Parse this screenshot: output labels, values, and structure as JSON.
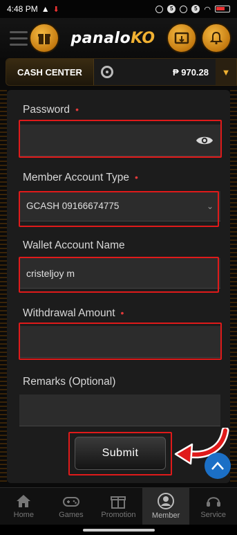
{
  "status_bar": {
    "time": "4:48 PM"
  },
  "header": {
    "logo_text": "panalo",
    "logo_suffix": "KO"
  },
  "cash_center": {
    "label": "CASH CENTER",
    "balance": "₱ 970.28"
  },
  "form": {
    "password": {
      "label": "Password",
      "value": ""
    },
    "account_type": {
      "label": "Member Account Type",
      "value": "GCASH 09166674775"
    },
    "wallet_name": {
      "label": "Wallet Account Name",
      "value": "cristeljoy m"
    },
    "amount": {
      "label": "Withdrawal Amount",
      "value": ""
    },
    "remarks": {
      "label": "Remarks (Optional)",
      "value": ""
    },
    "required_mark": "•",
    "submit_label": "Submit"
  },
  "bottom_nav": [
    {
      "label": "Home",
      "icon": "home-icon"
    },
    {
      "label": "Games",
      "icon": "gamepad-icon"
    },
    {
      "label": "Promotion",
      "icon": "gift-icon"
    },
    {
      "label": "Member",
      "icon": "user-icon",
      "active": true
    },
    {
      "label": "Service",
      "icon": "headset-icon"
    }
  ],
  "colors": {
    "accent": "#f0b132",
    "highlight_red": "#e01a1a",
    "scroll_button": "#1b6fc6"
  }
}
